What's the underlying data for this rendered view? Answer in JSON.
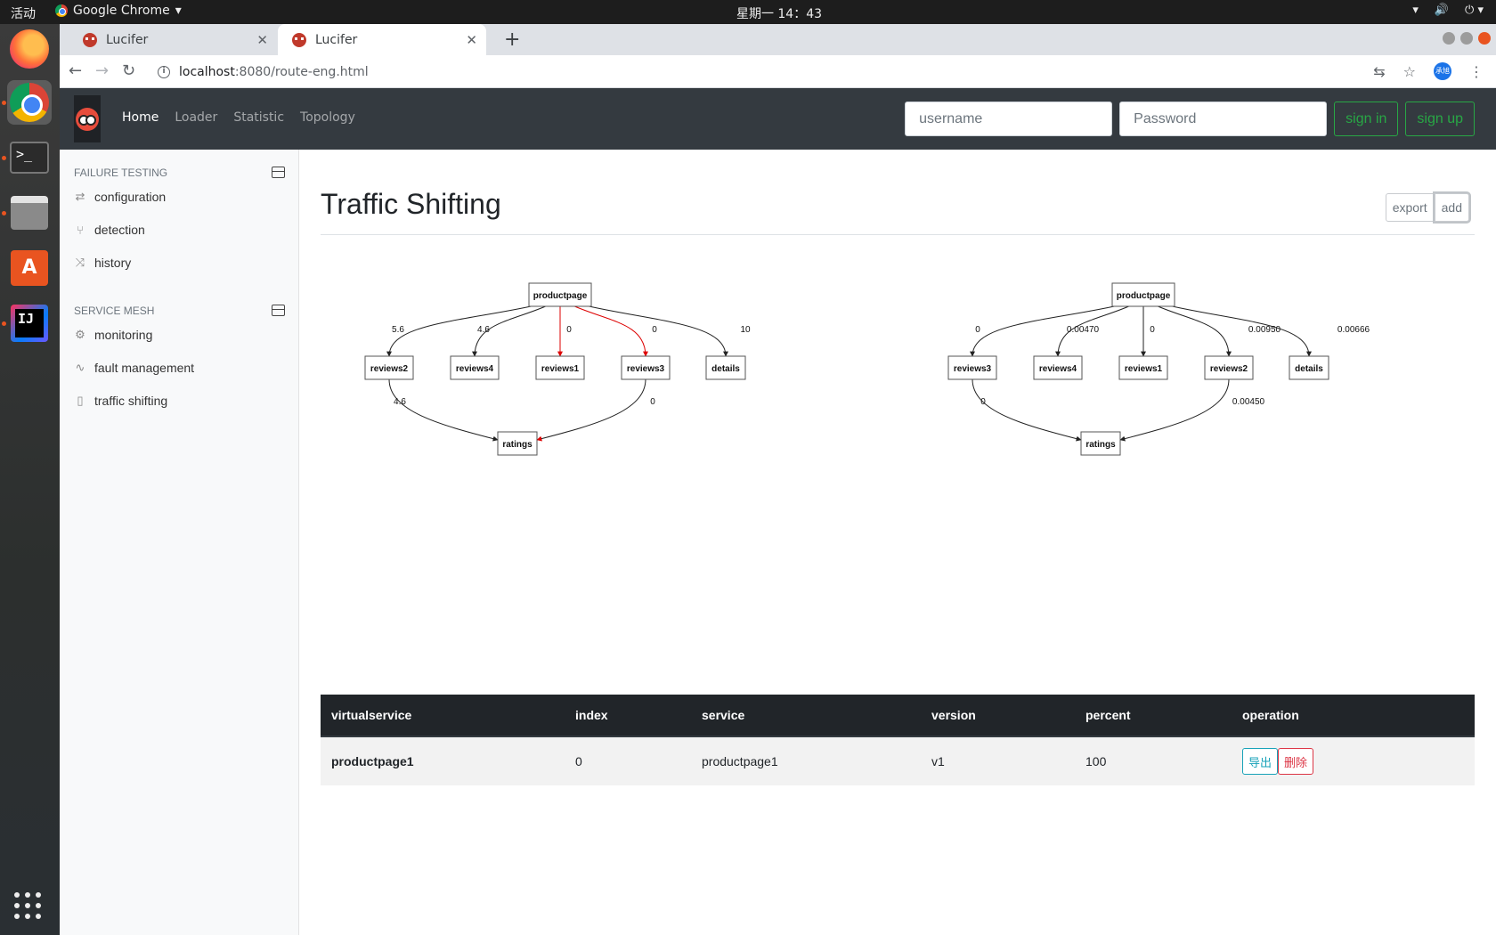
{
  "os": {
    "activities": "活动",
    "app_name": "Google Chrome",
    "clock": "星期一 14：43"
  },
  "browser": {
    "tabs": [
      {
        "title": "Lucifer"
      },
      {
        "title": "Lucifer"
      }
    ],
    "url_host": "localhost",
    "url_path": ":8080/route-eng.html",
    "profile_label": "承旭"
  },
  "navbar": {
    "links": [
      "Home",
      "Loader",
      "Statistic",
      "Topology"
    ],
    "username_placeholder": "username",
    "password_placeholder": "Password",
    "signin_label": "sign in",
    "signup_label": "sign up"
  },
  "sidebar": {
    "section1": "FAILURE TESTING",
    "section1_items": [
      {
        "label": "configuration",
        "icon": "repeat-icon"
      },
      {
        "label": "detection",
        "icon": "git-pull-icon"
      },
      {
        "label": "history",
        "icon": "shuffle-icon"
      }
    ],
    "section2": "SERVICE MESH",
    "section2_items": [
      {
        "label": "monitoring",
        "icon": "gear-icon"
      },
      {
        "label": "fault management",
        "icon": "activity-icon"
      },
      {
        "label": "traffic shifting",
        "icon": "file-icon"
      }
    ]
  },
  "main": {
    "title": "Traffic Shifting",
    "export_label": "export",
    "add_label": "add"
  },
  "graphs": [
    {
      "root": "productpage",
      "children": [
        "reviews2",
        "reviews4",
        "reviews1",
        "reviews3",
        "details"
      ],
      "edge_labels": [
        "5.6",
        "4.6",
        "0",
        "0",
        "10"
      ],
      "sink": "ratings",
      "sink_labels": [
        "4.6",
        "0"
      ],
      "red_edges": [
        "reviews1",
        "reviews3"
      ]
    },
    {
      "root": "productpage",
      "children": [
        "reviews3",
        "reviews4",
        "reviews1",
        "reviews2",
        "details"
      ],
      "edge_labels": [
        "0",
        "0.00470",
        "0",
        "0.00950",
        "0.00666"
      ],
      "sink": "ratings",
      "sink_labels": [
        "0",
        "0.00450"
      ],
      "red_edges": []
    }
  ],
  "table": {
    "headers": [
      "virtualservice",
      "index",
      "service",
      "version",
      "percent",
      "operation"
    ],
    "rows": [
      {
        "virtualservice": "productpage1",
        "index": "0",
        "service": "productpage1",
        "version": "v1",
        "percent": "100",
        "export": "导出",
        "delete": "删除"
      }
    ]
  }
}
